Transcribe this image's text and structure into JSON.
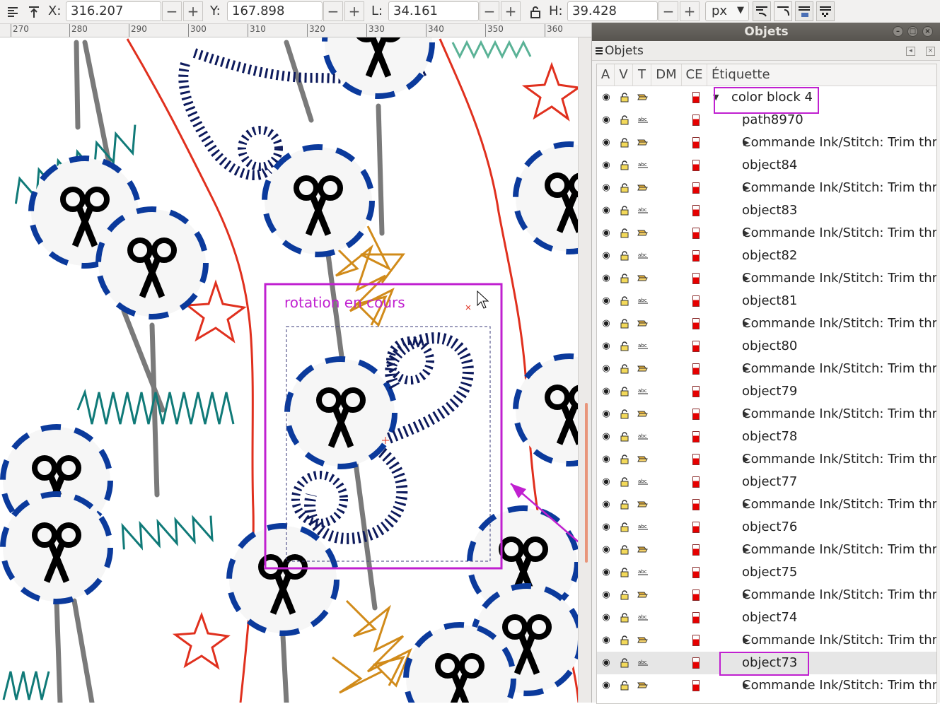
{
  "toolbar": {
    "x_label": "X:",
    "x_value": "316.207",
    "y_label": "Y:",
    "y_value": "167.898",
    "w_label": "L:",
    "w_value": "34.161",
    "h_label": "H:",
    "h_value": "39.428",
    "minus": "−",
    "plus": "+",
    "unit": "px"
  },
  "ruler": {
    "ticks": [
      "270",
      "280",
      "290",
      "300",
      "310",
      "320",
      "330",
      "340",
      "350",
      "360"
    ]
  },
  "canvas": {
    "annotation_text": "rotation en cours"
  },
  "panel": {
    "window_title": "Objets",
    "dock_title": "Objets",
    "columns": [
      "A",
      "V",
      "T",
      "DM",
      "CE",
      "Étiquette"
    ],
    "rows": [
      {
        "label": "color block 4",
        "kind": "group",
        "expanded": true,
        "indent": 0
      },
      {
        "label": "path8970",
        "kind": "text",
        "indent": 1
      },
      {
        "label": "Commande Ink/Stitch: Trim thre",
        "kind": "group",
        "indent": 1
      },
      {
        "label": "object84",
        "kind": "text",
        "indent": 1
      },
      {
        "label": "Commande Ink/Stitch: Trim thre",
        "kind": "group",
        "indent": 1
      },
      {
        "label": "object83",
        "kind": "text",
        "indent": 1
      },
      {
        "label": "Commande Ink/Stitch: Trim thre",
        "kind": "group",
        "indent": 1
      },
      {
        "label": "object82",
        "kind": "text",
        "indent": 1
      },
      {
        "label": "Commande Ink/Stitch: Trim thre",
        "kind": "group",
        "indent": 1
      },
      {
        "label": "object81",
        "kind": "text",
        "indent": 1
      },
      {
        "label": "Commande Ink/Stitch: Trim thre",
        "kind": "group",
        "indent": 1
      },
      {
        "label": "object80",
        "kind": "text",
        "indent": 1
      },
      {
        "label": "Commande Ink/Stitch: Trim thre",
        "kind": "group",
        "indent": 1
      },
      {
        "label": "object79",
        "kind": "text",
        "indent": 1
      },
      {
        "label": "Commande Ink/Stitch: Trim thre",
        "kind": "group",
        "indent": 1
      },
      {
        "label": "object78",
        "kind": "text",
        "indent": 1
      },
      {
        "label": "Commande Ink/Stitch: Trim thre",
        "kind": "group",
        "indent": 1
      },
      {
        "label": "object77",
        "kind": "text",
        "indent": 1
      },
      {
        "label": "Commande Ink/Stitch: Trim thre",
        "kind": "group",
        "indent": 1
      },
      {
        "label": "object76",
        "kind": "text",
        "indent": 1
      },
      {
        "label": "Commande Ink/Stitch: Trim thre",
        "kind": "group",
        "indent": 1
      },
      {
        "label": "object75",
        "kind": "text",
        "indent": 1
      },
      {
        "label": "Commande Ink/Stitch: Trim thre",
        "kind": "group",
        "indent": 1
      },
      {
        "label": "object74",
        "kind": "text",
        "indent": 1
      },
      {
        "label": "Commande Ink/Stitch: Trim thre",
        "kind": "group",
        "indent": 1
      },
      {
        "label": "object73",
        "kind": "text",
        "indent": 1,
        "selected": true
      },
      {
        "label": "Commande Ink/Stitch: Trim thre",
        "kind": "group",
        "indent": 1
      }
    ]
  },
  "colors": {
    "annotation": "#c020d0",
    "dark_blue": "#0d1a5c",
    "dash_blue": "#0b3a9c",
    "teal": "#107a78",
    "mint": "#5ab296",
    "gold": "#d18b1a",
    "red": "#e0301e",
    "gray": "#7a7a7a"
  }
}
